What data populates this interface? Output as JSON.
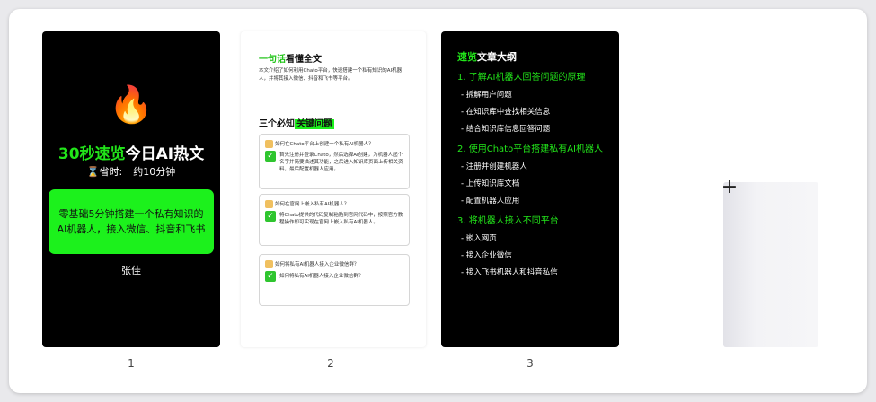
{
  "pages": [
    {
      "number": "1",
      "icon": "fire-icon",
      "emoji": "🔥",
      "title_highlight": "30秒速览",
      "title_rest": "今日AI热文",
      "time_icon": "⌛",
      "time_label": "省时:",
      "time_value": "约10分钟",
      "highlight_box": "零基础5分钟搭建一个私有知识的AI机器人，接入微信、抖音和飞书",
      "author": "张佳"
    },
    {
      "number": "2",
      "heading_highlight": "一句话",
      "heading_rest": "看懂全文",
      "summary": "本文介绍了如何利用Chato平台，快速搭建一个私有知识的AI机器人，并将其接入微信、抖音和飞书等平台。",
      "questions_prefix": "三个必知",
      "questions_highlight": "关键问题",
      "qa": [
        {
          "q": "如何在Chato平台上创建一个私有AI机器人？",
          "a": "首先注册并登录Chato，然后选择AI创建，为机器人起个名字并简要描述其功能，之后进入知识库页面上传相关资料，最后配置机器人应用。"
        },
        {
          "q": "如何在官网上嵌入私有AI机器人？",
          "a": "将Chato提供的代码复制粘贴到官网代码中，按照官方教程操作即可实现在官网上嵌入私有AI机器人。"
        },
        {
          "q": "如何将私有AI机器人接入企业微信群？",
          "a": "如何将私有AI机器人接入企业微信群？"
        }
      ]
    },
    {
      "number": "3",
      "title_highlight": "速览",
      "title_rest": "文章大纲",
      "outline": [
        {
          "section": "1. 了解AI机器人回答问题的原理",
          "items": [
            "- 拆解用户问题",
            "- 在知识库中查找相关信息",
            "- 结合知识库信息回答问题"
          ]
        },
        {
          "section": "2. 使用Chato平台搭建私有AI机器人",
          "items": [
            "- 注册并创建机器人",
            "- 上传知识库文档",
            "- 配置机器人应用"
          ]
        },
        {
          "section": "3. 将机器人接入不同平台",
          "items": [
            "- 嵌入网页",
            "- 接入企业微信",
            "- 接入飞书机器人和抖音私信"
          ]
        }
      ]
    }
  ],
  "add_page": {
    "icon": "plus-icon",
    "glyph": "+"
  },
  "colors": {
    "accent_green": "#1cf11c",
    "dark_card": "#000000"
  }
}
